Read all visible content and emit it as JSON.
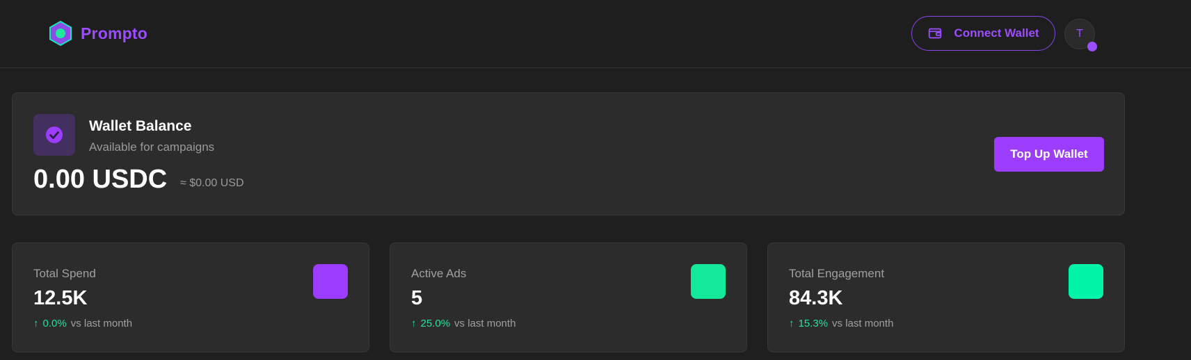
{
  "header": {
    "brand_name": "Prompto",
    "connect_label": "Connect Wallet",
    "avatar_initial": "T"
  },
  "wallet": {
    "title": "Wallet Balance",
    "subtitle": "Available for campaigns",
    "amount": "0.00 USDC",
    "usd_equivalent": "≈ $0.00 USD",
    "topup_label": "Top Up Wallet"
  },
  "stats": [
    {
      "label": "Total Spend",
      "value": "12.5K",
      "trend_pct": "0.0%",
      "trend_text": "vs last month",
      "accent": "#9b3cff"
    },
    {
      "label": "Active Ads",
      "value": "5",
      "trend_pct": "25.0%",
      "trend_text": "vs last month",
      "accent": "#14e89a"
    },
    {
      "label": "Total Engagement",
      "value": "84.3K",
      "trend_pct": "15.3%",
      "trend_text": "vs last month",
      "accent": "#00f5a8"
    }
  ],
  "colors": {
    "brand": "#9c4dff",
    "positive": "#22e39a",
    "background": "#1f1f1f",
    "card": "#2c2c2c"
  },
  "icons": {
    "logo": "hexagon-logo-icon",
    "connect": "wallet-icon",
    "wallet_card": "check-circle-icon",
    "trend": "arrow-up-icon"
  }
}
